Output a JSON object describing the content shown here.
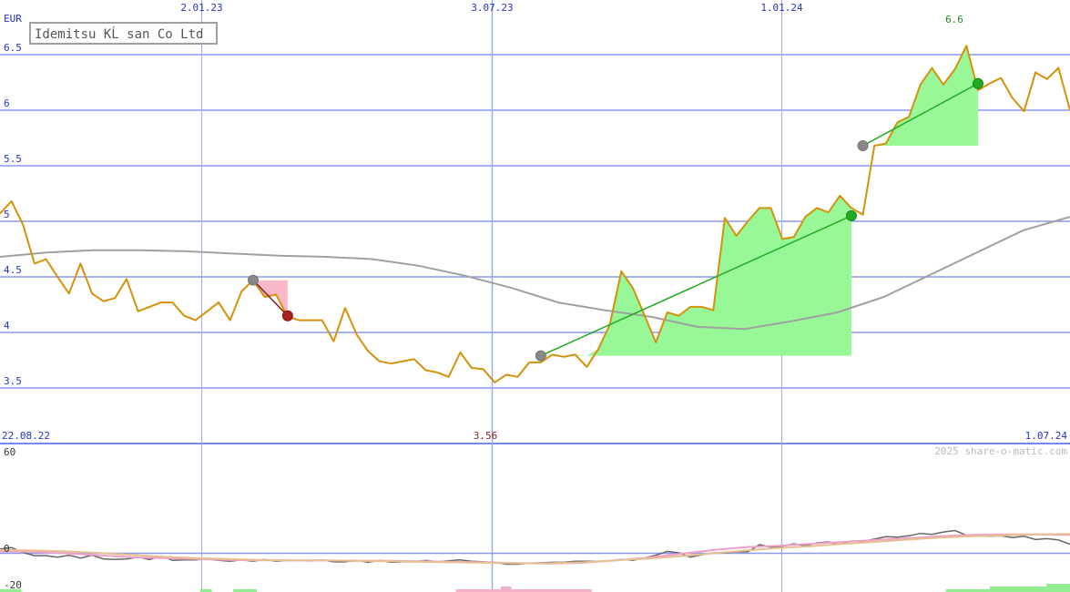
{
  "chart_data": {
    "type": "line",
    "title": "Idemitsu KĹ san Co Ltd",
    "currency": "EUR",
    "watermark": "2025 share-o-matic.com",
    "date_start": "22.08.22",
    "date_end": "1.07.24",
    "x_ticks": [
      "2.01.23",
      "3.07.23",
      "1.01.24"
    ],
    "price_axis": {
      "ylim": [
        3.0,
        6.85
      ],
      "ticks": [
        "3.5",
        "4",
        "4.5",
        "5",
        "5.5",
        "6",
        "6.5"
      ]
    },
    "annotations": {
      "min_label": "3.56",
      "max_label": "6.6"
    },
    "series": [
      {
        "name": "price",
        "color": "#d4920a",
        "values": [
          5.07,
          5.18,
          4.97,
          4.62,
          4.66,
          4.5,
          4.35,
          4.62,
          4.35,
          4.28,
          4.31,
          4.48,
          4.19,
          4.23,
          4.27,
          4.27,
          4.15,
          4.11,
          4.19,
          4.27,
          4.11,
          4.37,
          4.47,
          4.32,
          4.34,
          4.14,
          4.11,
          4.11,
          4.11,
          3.92,
          4.22,
          3.98,
          3.83,
          3.74,
          3.72,
          3.74,
          3.76,
          3.66,
          3.64,
          3.6,
          3.82,
          3.68,
          3.67,
          3.55,
          3.62,
          3.6,
          3.73,
          3.73,
          3.8,
          3.78,
          3.8,
          3.69,
          3.85,
          4.07,
          4.55,
          4.4,
          4.16,
          3.91,
          4.18,
          4.15,
          4.23,
          4.23,
          4.2,
          5.03,
          4.87,
          5.0,
          5.12,
          5.12,
          4.84,
          4.86,
          5.04,
          5.12,
          5.08,
          5.23,
          5.12,
          5.06,
          5.68,
          5.7,
          5.89,
          5.94,
          6.23,
          6.38,
          6.23,
          6.37,
          6.58,
          6.18,
          6.24,
          6.29,
          6.11,
          5.99,
          6.34,
          6.28,
          6.38,
          6.0
        ]
      },
      {
        "name": "moving average",
        "color": "#a0a0a0",
        "values": [
          4.68,
          4.72,
          4.74,
          4.74,
          4.73,
          4.71,
          4.69,
          4.68,
          4.66,
          4.6,
          4.51,
          4.4,
          4.27,
          4.2,
          4.14,
          4.05,
          4.03,
          4.1,
          4.18,
          4.32,
          4.52,
          4.72,
          4.92,
          5.04
        ]
      }
    ],
    "trades": [
      {
        "type": "loss",
        "entry": 4.47,
        "exit": 4.15
      },
      {
        "type": "gain",
        "entry": 3.79,
        "exit": 5.05
      },
      {
        "type": "gain",
        "entry": 5.68,
        "exit": 6.24
      }
    ],
    "indicator": {
      "ylim": [
        -20,
        60
      ],
      "ticks": [
        "60",
        "0",
        "-20"
      ],
      "series": [
        {
          "name": "oscillator",
          "color": "#666666",
          "values": [
            9,
            12,
            2,
            -5,
            -5,
            -8,
            -4,
            -10,
            -4,
            -12,
            -13,
            -12,
            -8,
            -13,
            -6,
            -15,
            -14,
            -14,
            -12,
            -15,
            -17,
            -14,
            -17,
            -13,
            -17,
            -15,
            -15,
            -16,
            -14,
            -18,
            -18,
            -15,
            -19,
            -15,
            -19,
            -18,
            -18,
            -15,
            -18,
            -16,
            -14,
            -17,
            -18,
            -19,
            -23,
            -23,
            -21,
            -20,
            -19,
            -19,
            -17,
            -17,
            -17,
            -16,
            -13,
            -15,
            -10,
            -4,
            4,
            1,
            -8,
            -3,
            1,
            1,
            3,
            3,
            18,
            13,
            15,
            20,
            16,
            22,
            24,
            19,
            26,
            25,
            30,
            35,
            34,
            37,
            42,
            40,
            45,
            48,
            38,
            37,
            36,
            37,
            33,
            36,
            29,
            31,
            28,
            19
          ]
        },
        {
          "name": "signal fast",
          "color": "#f0a0c8",
          "values": [
            4,
            3,
            0,
            -4,
            -8,
            -10,
            -12,
            -14,
            -15,
            -15,
            -15,
            -16,
            -16,
            -17,
            -18,
            -19,
            -21,
            -22,
            -20,
            -15,
            -9,
            -1,
            7,
            13,
            16,
            20,
            24,
            28,
            32,
            36,
            39,
            40,
            40,
            39
          ]
        },
        {
          "name": "signal slow",
          "color": "#e8c090",
          "values": [
            7,
            6,
            4,
            1,
            -3,
            -7,
            -10,
            -12,
            -14,
            -15,
            -15,
            -16,
            -17,
            -18,
            -19,
            -20,
            -21,
            -21,
            -19,
            -15,
            -11,
            -6,
            0,
            6,
            11,
            15,
            20,
            24,
            29,
            33,
            36,
            38,
            40,
            41
          ]
        }
      ]
    },
    "bottom_bars": [
      {
        "color": "#90ee90",
        "from": 0.0,
        "to": 0.02,
        "value": 1
      },
      {
        "color": "#90ee90",
        "from": 0.187,
        "to": 0.198,
        "value": 1
      },
      {
        "color": "#90ee90",
        "from": 0.218,
        "to": 0.24,
        "value": 1
      },
      {
        "color": "#f4b0c4",
        "from": 0.426,
        "to": 0.553,
        "value": 1
      },
      {
        "color": "#f4b0c4",
        "from": 0.468,
        "to": 0.478,
        "value": 2
      },
      {
        "color": "#90ee90",
        "from": 0.884,
        "to": 0.925,
        "value": 1
      },
      {
        "color": "#90ee90",
        "from": 0.925,
        "to": 0.978,
        "value": 2
      },
      {
        "color": "#90ee90",
        "from": 0.978,
        "to": 1.0,
        "value": 3
      }
    ]
  }
}
